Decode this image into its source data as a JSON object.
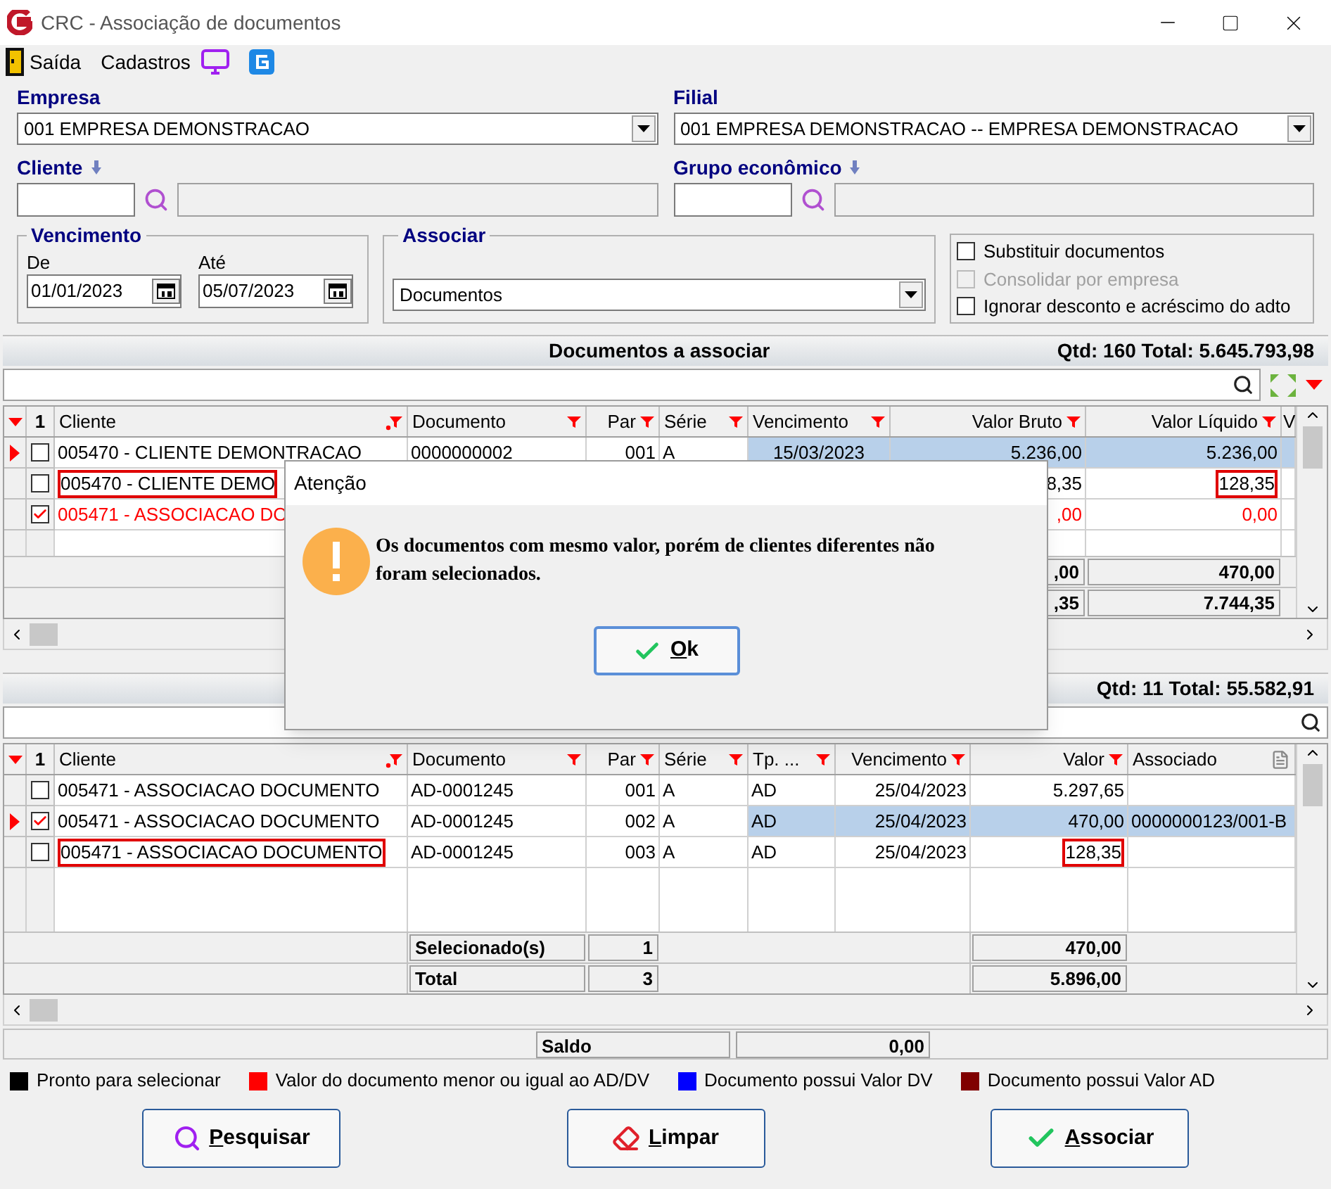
{
  "window": {
    "title": "CRC - Associação de documentos"
  },
  "menu": [
    {
      "label": "Saída"
    },
    {
      "label": "Cadastros"
    }
  ],
  "empresa": {
    "label": "Empresa",
    "value": "001 EMPRESA DEMONSTRACAO"
  },
  "filial": {
    "label": "Filial",
    "value": "001 EMPRESA DEMONSTRACAO -- EMPRESA DEMONSTRACAO"
  },
  "cliente": {
    "label": "Cliente"
  },
  "grupo": {
    "label": "Grupo econômico"
  },
  "vencimento": {
    "label": "Vencimento",
    "de_label": "De",
    "de": "01/01/2023",
    "ate_label": "Até",
    "ate": "05/07/2023"
  },
  "associar": {
    "label": "Associar",
    "value": "Documentos"
  },
  "options": [
    {
      "label": "Substituir documentos",
      "checked": false,
      "disabled": false
    },
    {
      "label": "Consolidar por empresa",
      "checked": false,
      "disabled": true
    },
    {
      "label": "Ignorar desconto e acréscimo do adto",
      "checked": false,
      "disabled": false
    }
  ],
  "upper": {
    "title": "Documentos a associar",
    "summary": "Qtd: 160 Total: 5.645.793,98",
    "check_header": "1",
    "columns": [
      {
        "label": "Cliente",
        "kind": "sort"
      },
      {
        "label": "Documento",
        "kind": "filter"
      },
      {
        "label": "Par",
        "kind": "filter"
      },
      {
        "label": "Série",
        "kind": "filter"
      },
      {
        "label": "Vencimento",
        "kind": "filter"
      },
      {
        "label": "Valor Bruto",
        "kind": "filter"
      },
      {
        "label": "Valor Líquido",
        "kind": "filter"
      },
      {
        "label": "V",
        "kind": "plain"
      }
    ],
    "rows": [
      {
        "selected": true,
        "checked": false,
        "color": "#000000",
        "cells": [
          {
            "text": "005470 - CLIENTE DEMONTRACAO",
            "boxed": false
          },
          {
            "text": "0000000002",
            "boxed": false
          },
          {
            "text": "001",
            "boxed": false
          },
          {
            "text": "A",
            "boxed": false
          },
          {
            "text": "15/03/2023",
            "boxed": false
          },
          {
            "text": "5.236,00",
            "boxed": false
          },
          {
            "text": "5.236,00",
            "boxed": false
          },
          {
            "boxed": false
          }
        ]
      },
      {
        "selected": false,
        "checked": false,
        "color": "#000000",
        "cells": [
          {
            "text": "005470 - CLIENTE DEMO",
            "boxed": true
          },
          null,
          null,
          null,
          null,
          {
            "text": "8,35",
            "boxed": false
          },
          {
            "text": "128,35",
            "boxed": true
          },
          {
            "boxed": false
          }
        ]
      },
      {
        "selected": false,
        "checked": true,
        "color": "#ff0000",
        "cells": [
          {
            "text": "005471 - ASSOCIACAO DO",
            "boxed": false
          },
          null,
          null,
          null,
          null,
          {
            "text": ",00",
            "boxed": false
          },
          {
            "text": "0,00",
            "boxed": false
          },
          {
            "boxed": false
          }
        ]
      }
    ],
    "totals": [
      {
        "bruto": ",00",
        "liquido": "470,00"
      },
      {
        "bruto": ",35",
        "liquido": "7.744,35"
      }
    ]
  },
  "lower": {
    "summary": "Qtd: 11 Total: 55.582,91",
    "check_header": "1",
    "columns": [
      {
        "label": "Cliente",
        "kind": "sort"
      },
      {
        "label": "Documento",
        "kind": "filter"
      },
      {
        "label": "Par",
        "kind": "filter"
      },
      {
        "label": "Série",
        "kind": "filter"
      },
      {
        "label": "Tp. ...",
        "kind": "filter"
      },
      {
        "label": "Vencimento",
        "kind": "filter"
      },
      {
        "label": "Valor",
        "kind": "filter"
      },
      {
        "label": "Associado",
        "kind": "doc"
      }
    ],
    "rows": [
      {
        "selected": false,
        "checked": false,
        "color": "#000000",
        "cells": [
          {
            "text": "005471 - ASSOCIACAO DOCUMENTO",
            "boxed": false
          },
          {
            "text": "AD-0001245",
            "boxed": false
          },
          {
            "text": "001",
            "boxed": false
          },
          {
            "text": "A",
            "boxed": false
          },
          {
            "text": "AD",
            "boxed": false
          },
          {
            "text": "25/04/2023",
            "boxed": false
          },
          {
            "text": "5.297,65",
            "boxed": false
          },
          {
            "boxed": false
          }
        ]
      },
      {
        "selected": true,
        "checked": true,
        "color": "#000000",
        "cells": [
          {
            "text": "005471 - ASSOCIACAO DOCUMENTO",
            "boxed": false
          },
          {
            "text": "AD-0001245",
            "boxed": false
          },
          {
            "text": "002",
            "boxed": false
          },
          {
            "text": "A",
            "boxed": false
          },
          {
            "text": "AD",
            "boxed": false
          },
          {
            "text": "25/04/2023",
            "boxed": false
          },
          {
            "text": "470,00",
            "boxed": false
          },
          {
            "text": "0000000123/001-B",
            "boxed": false
          }
        ]
      },
      {
        "selected": false,
        "checked": false,
        "color": "#000000",
        "cells": [
          {
            "text": "005471 - ASSOCIACAO DOCUMENTO",
            "boxed": true
          },
          {
            "text": "AD-0001245",
            "boxed": false
          },
          {
            "text": "003",
            "boxed": false
          },
          {
            "text": "A",
            "boxed": false
          },
          {
            "text": "AD",
            "boxed": false
          },
          {
            "text": "25/04/2023",
            "boxed": false
          },
          {
            "text": "128,35",
            "boxed": true
          },
          {
            "boxed": false
          }
        ]
      }
    ],
    "totals": [
      {
        "label": "Selecionado(s)",
        "count": "1",
        "value": "470,00"
      },
      {
        "label": "Total",
        "count": "3",
        "value": "5.896,00"
      }
    ]
  },
  "saldo": {
    "label": "Saldo",
    "value": "0,00"
  },
  "legend": [
    {
      "label": "Pronto para selecionar",
      "color": "#000000"
    },
    {
      "label": "Valor do documento menor ou igual ao AD/DV",
      "color": "#ff0000"
    },
    {
      "label": "Documento possui Valor DV",
      "color": "#0000ff"
    },
    {
      "label": "Documento possui Valor AD",
      "color": "#800000"
    }
  ],
  "buttons": [
    {
      "label": "Pesquisar",
      "kind": "search"
    },
    {
      "label": "Limpar",
      "kind": "clear"
    },
    {
      "label": "Associar",
      "kind": "confirm"
    }
  ],
  "dialog": {
    "title": "Atenção",
    "message": "Os documentos com mesmo valor, porém de clientes diferentes não foram selecionados.",
    "button": "Ok"
  }
}
